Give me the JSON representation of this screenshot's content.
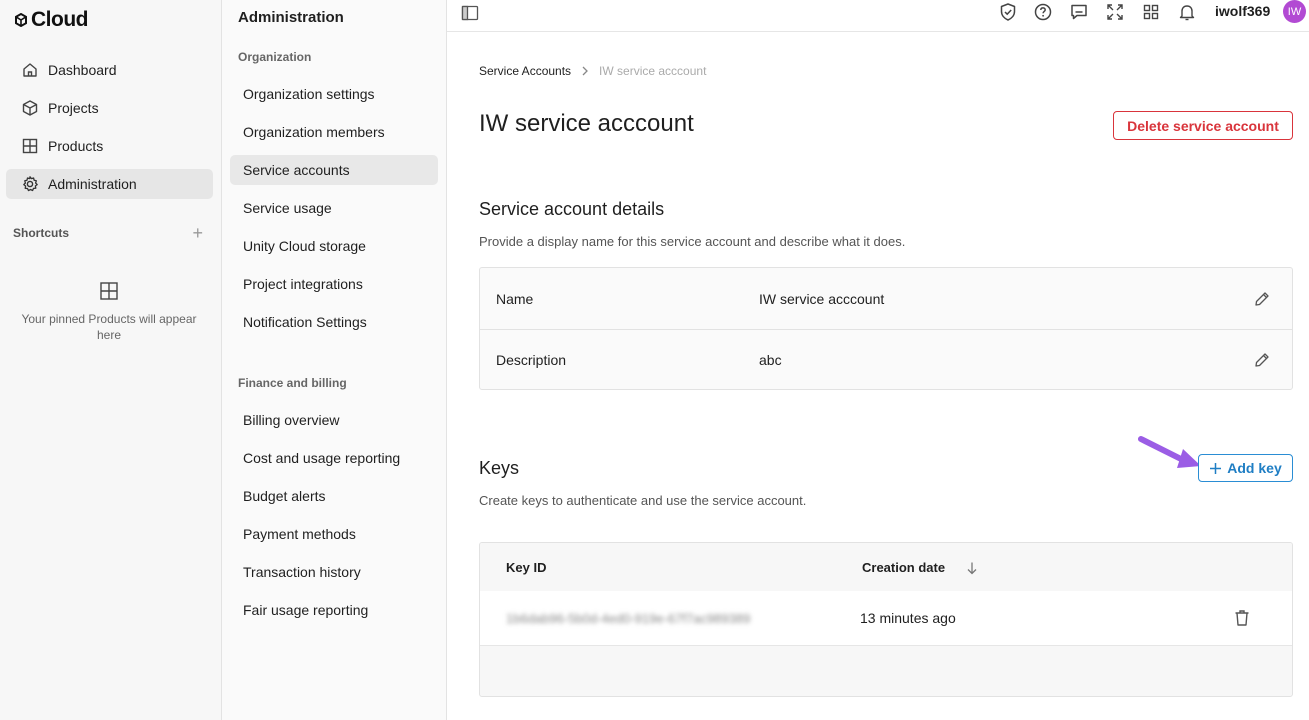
{
  "brand": {
    "logo_text": "Cloud"
  },
  "leftnav": {
    "items": [
      {
        "label": "Dashboard",
        "icon": "home-icon"
      },
      {
        "label": "Projects",
        "icon": "cube-icon"
      },
      {
        "label": "Products",
        "icon": "grid-icon"
      },
      {
        "label": "Administration",
        "icon": "gear-icon",
        "active": true
      }
    ],
    "shortcuts_label": "Shortcuts",
    "shortcuts_add": "+",
    "pinned_empty_text": "Your pinned Products will appear here"
  },
  "subnav": {
    "title": "Administration",
    "sections": [
      {
        "label": "Organization",
        "items": [
          "Organization settings",
          "Organization members",
          "Service accounts",
          "Service usage",
          "Unity Cloud storage",
          "Project integrations",
          "Notification Settings"
        ]
      },
      {
        "label": "Finance and billing",
        "items": [
          "Billing overview",
          "Cost and usage reporting",
          "Budget alerts",
          "Payment methods",
          "Transaction history",
          "Fair usage reporting"
        ]
      }
    ],
    "active_item": "Service accounts"
  },
  "topbar": {
    "icons": [
      "panel-toggle-icon",
      "shield-icon",
      "help-icon",
      "feedback-icon",
      "fullscreen-icon",
      "apps-grid-icon",
      "bell-icon"
    ],
    "username": "iwolf369",
    "avatar_initials": "IW",
    "avatar_color": "#b24ad3"
  },
  "breadcrumb": {
    "parent": "Service Accounts",
    "current": "IW service acccount"
  },
  "page": {
    "title": "IW service acccount",
    "delete_button": "Delete service account"
  },
  "details": {
    "title": "Service account details",
    "description": "Provide a display name for this service account and describe what it does.",
    "rows": [
      {
        "label": "Name",
        "value": "IW service acccount"
      },
      {
        "label": "Description",
        "value": "abc"
      }
    ]
  },
  "keys": {
    "title": "Keys",
    "description": "Create keys to authenticate and use the service account.",
    "add_button": "Add key",
    "columns": [
      "Key ID",
      "Creation date"
    ],
    "rows": [
      {
        "key_id": "1b6dab96-5b0d-4ed0-919e-67f7ac989389",
        "created": "13 minutes ago"
      }
    ]
  },
  "colors": {
    "danger": "#d9343b",
    "primary": "#1f7ec4",
    "annotation_arrow": "#9b5de5"
  }
}
